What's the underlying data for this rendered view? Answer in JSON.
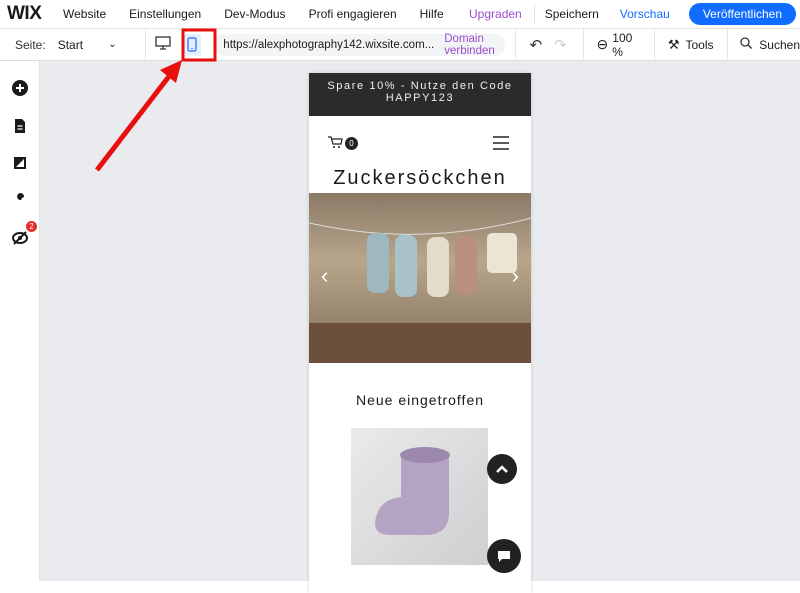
{
  "topbar": {
    "logo": "WIX",
    "menu": [
      "Website",
      "Einstellungen",
      "Dev-Modus",
      "Profi engagieren",
      "Hilfe"
    ],
    "upgrade": "Upgraden",
    "save": "Speichern",
    "preview": "Vorschau",
    "publish": "Veröffentlichen"
  },
  "toolbar": {
    "page_label": "Seite:",
    "page_value": "Start",
    "url": "https://alexphotography142.wixsite.com...",
    "connect_domain": "Domain verbinden",
    "zoom": "100 %",
    "tools": "Tools",
    "search": "Suchen"
  },
  "sidebar": {
    "badge": "2"
  },
  "site": {
    "banner": "Spare 10% - Nutze den Code HAPPY123",
    "cart_count": "0",
    "title": "Zuckersöckchen",
    "section_title": "Neue eingetroffen"
  },
  "colors": {
    "accent": "#116dff",
    "purple": "#9b4dca",
    "highlight": "#e8100f"
  }
}
